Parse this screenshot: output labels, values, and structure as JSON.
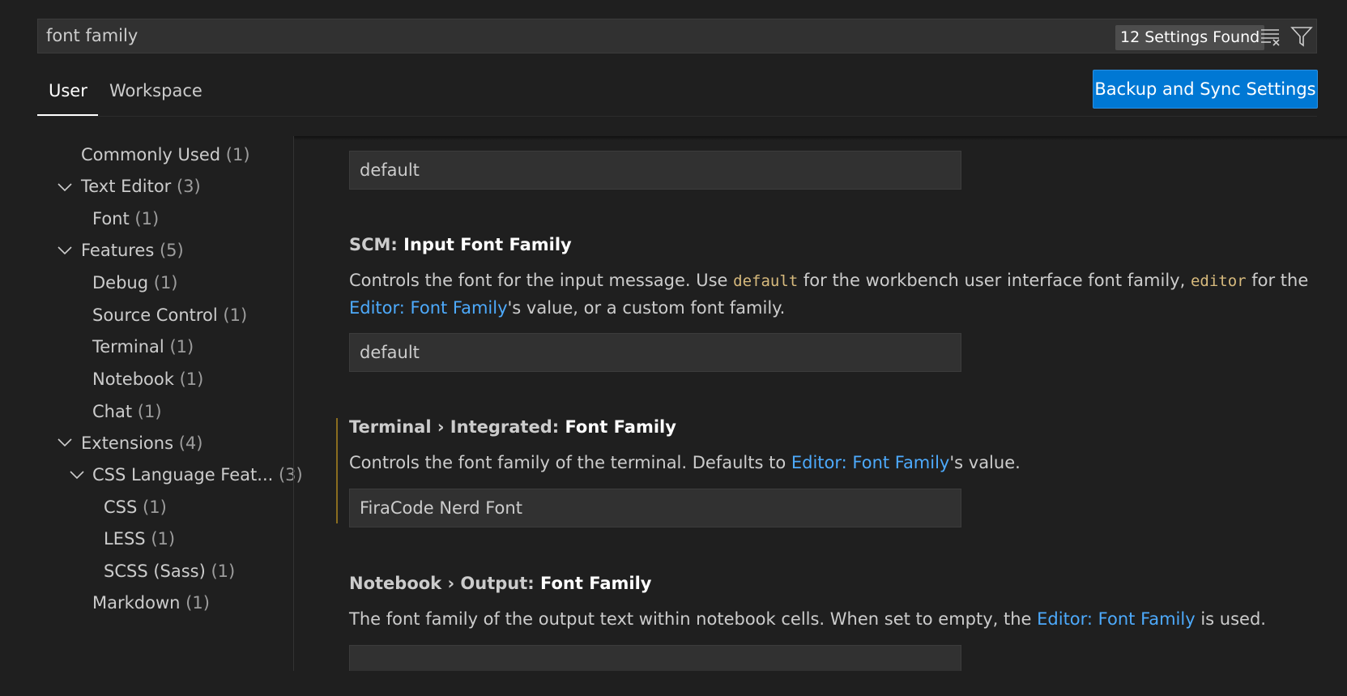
{
  "search": {
    "value": "font family",
    "results_badge": "12 Settings Found"
  },
  "tabs": [
    {
      "label": "User"
    },
    {
      "label": "Workspace"
    }
  ],
  "sync_button": {
    "label": "Backup and Sync Settings"
  },
  "toc": [
    {
      "label": "Commonly Used",
      "count": "(1)"
    },
    {
      "label": "Text Editor",
      "count": "(3)"
    },
    {
      "label": "Font",
      "count": "(1)"
    },
    {
      "label": "Features",
      "count": "(5)"
    },
    {
      "label": "Debug",
      "count": "(1)"
    },
    {
      "label": "Source Control",
      "count": "(1)"
    },
    {
      "label": "Terminal",
      "count": "(1)"
    },
    {
      "label": "Notebook",
      "count": "(1)"
    },
    {
      "label": "Chat",
      "count": "(1)"
    },
    {
      "label": "Extensions",
      "count": "(4)"
    },
    {
      "label": "CSS Language Feat...",
      "count": "(3)"
    },
    {
      "label": "CSS",
      "count": "(1)"
    },
    {
      "label": "LESS",
      "count": "(1)"
    },
    {
      "label": "SCSS (Sass)",
      "count": "(1)"
    },
    {
      "label": "Markdown",
      "count": "(1)"
    }
  ],
  "settings": {
    "prev_value": "default",
    "scm": {
      "category": "SCM: ",
      "name": "Input Font Family",
      "desc_1": "Controls the font for the input message. Use ",
      "code_1": "default",
      "desc_2": " for the workbench user interface font family, ",
      "code_2": "editor",
      "desc_3": " for the ",
      "link": "Editor: Font Family",
      "desc_4": "'s value, or a custom font family.",
      "value": "default"
    },
    "terminal": {
      "category": "Terminal › Integrated: ",
      "name": "Font Family",
      "desc_1": "Controls the font family of the terminal. Defaults to ",
      "link": "Editor: Font Family",
      "desc_2": "'s value.",
      "value": "FiraCode Nerd Font"
    },
    "notebook": {
      "category": "Notebook › Output: ",
      "name": "Font Family",
      "desc_1": "The font family of the output text within notebook cells. When set to empty, the ",
      "link": "Editor: Font Family",
      "desc_2": " is used.",
      "value": ""
    }
  },
  "colors": {
    "accent": "#0078d4",
    "link": "#4daafc",
    "modified": "#8a6d1f",
    "code": "#d7ba7d"
  }
}
